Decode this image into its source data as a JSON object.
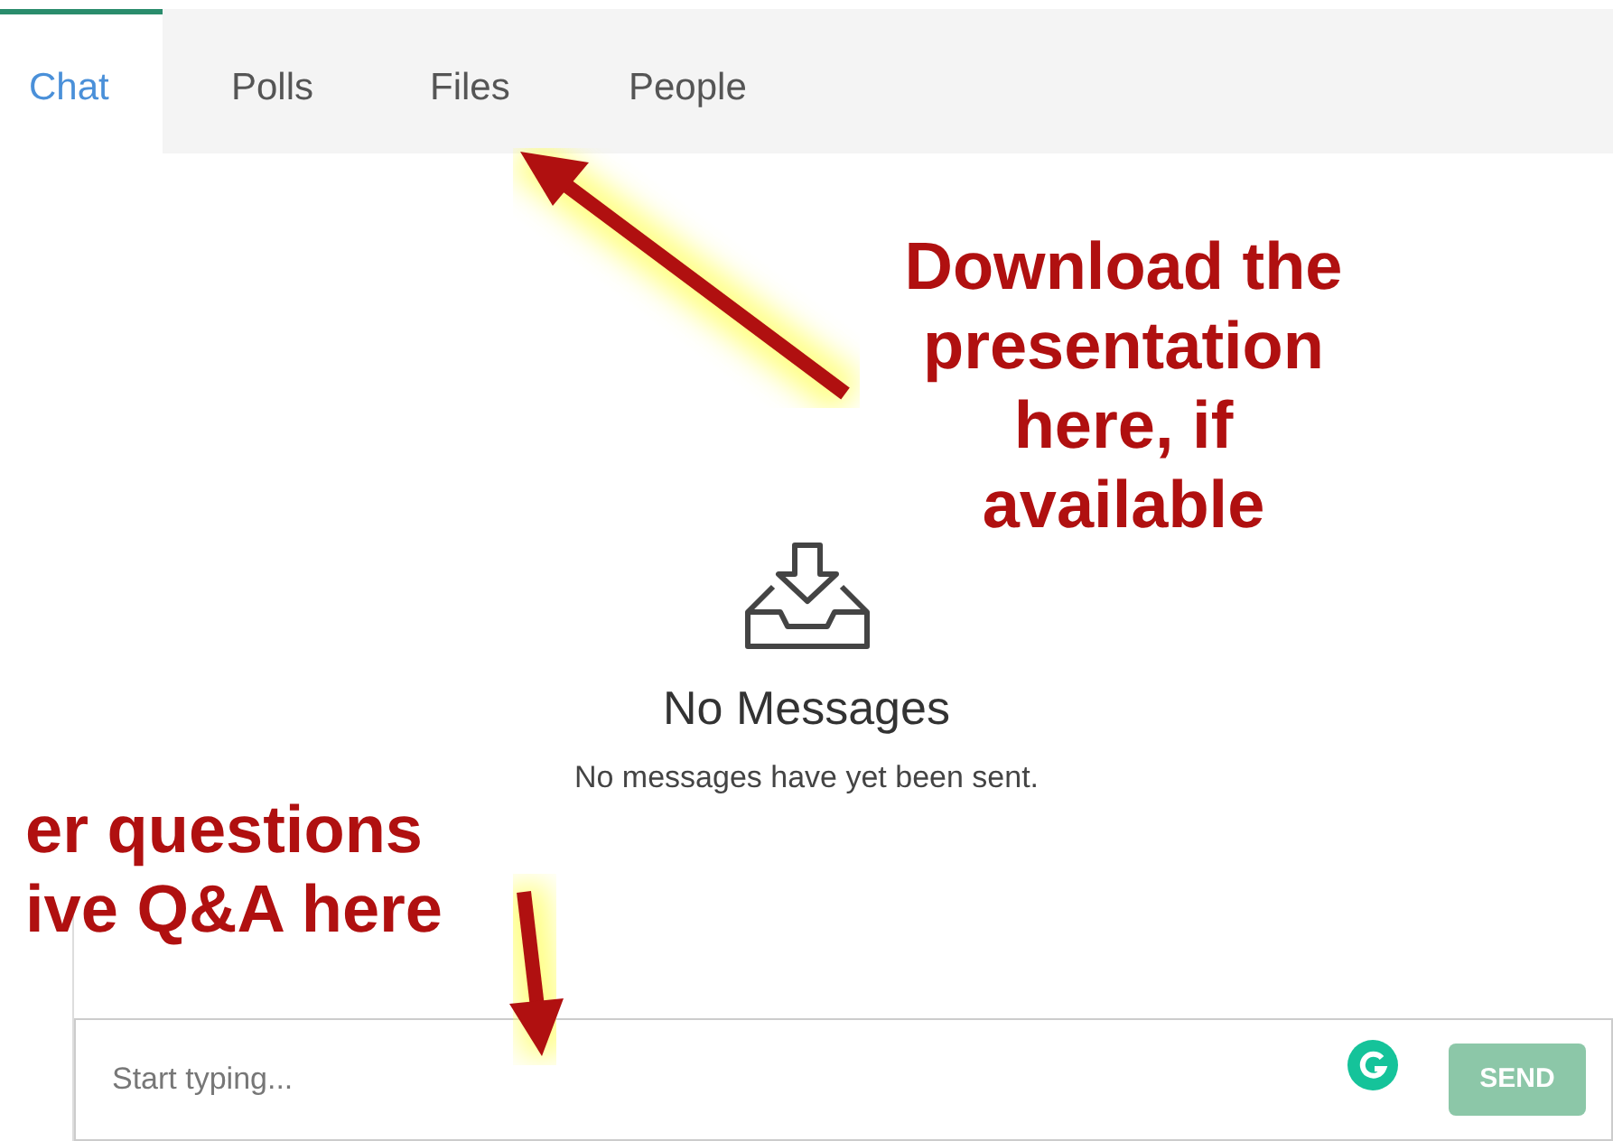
{
  "tabs": [
    {
      "label": "Chat",
      "selected": true
    },
    {
      "label": "Polls",
      "selected": false
    },
    {
      "label": "Files",
      "selected": false
    },
    {
      "label": "People",
      "selected": false
    }
  ],
  "empty_state": {
    "title": "No Messages",
    "message": "No messages have yet been sent."
  },
  "composer": {
    "placeholder": "Start typing...",
    "send_label": "SEND",
    "send_disabled": true
  },
  "annotations": [
    {
      "kind": "files",
      "text": "Download the\npresentation\nhere, if\navailable"
    },
    {
      "kind": "composer",
      "text": "er questions\nive Q&A here"
    }
  ]
}
